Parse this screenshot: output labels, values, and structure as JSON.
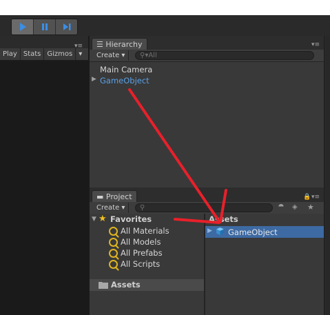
{
  "toolbar": {
    "buttons": [
      {
        "name": "play-button",
        "glyph": "▶"
      },
      {
        "name": "pause-button",
        "glyph": "❚❚"
      },
      {
        "name": "step-button",
        "glyph": "▶❚"
      }
    ]
  },
  "game": {
    "items": [
      "Play",
      "Stats",
      "Gizmos"
    ],
    "dropdown_glyph": "▾"
  },
  "hierarchy": {
    "tab_label": "Hierarchy",
    "create_label": "Create",
    "search_placeholder": "All",
    "menu_glyph": "▾≡",
    "items": [
      "Main Camera",
      "GameObject"
    ]
  },
  "project": {
    "tab_label": "Project",
    "create_label": "Create",
    "menu_glyph": "▾≡",
    "favorites_label": "Favorites",
    "favorites": [
      "All Materials",
      "All Models",
      "All Prefabs",
      "All Scripts"
    ],
    "assets_label": "Assets",
    "assets_header": "Assets",
    "asset_items": [
      "GameObject"
    ]
  },
  "colors": {
    "accent_blue": "#5aa0e6",
    "selection": "#3d6aa3",
    "arrow_red": "#e8202a",
    "star": "#f0c020"
  }
}
